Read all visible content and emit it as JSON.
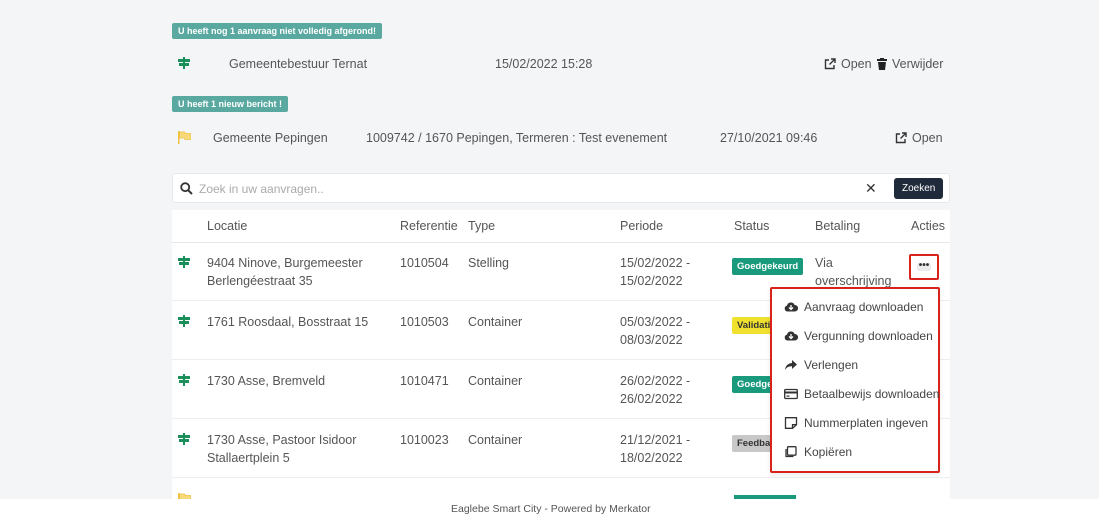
{
  "notifications": [
    {
      "badge": "U heeft nog 1 aanvraag niet volledig afgerond!",
      "org": "Gemeentebestuur Ternat",
      "datetime": "15/02/2022 15:28",
      "open_label": "Open",
      "delete_label": "Verwijder",
      "icon": "road-sign-icon"
    },
    {
      "badge": "U heeft 1 nieuw bericht !",
      "org": "Gemeente Pepingen",
      "description": "1009742 / 1670 Pepingen, Termeren : Test evenement",
      "datetime": "27/10/2021 09:46",
      "open_label": "Open",
      "icon": "flag-icon"
    }
  ],
  "search": {
    "placeholder": "Zoek in uw aanvragen..",
    "value": "",
    "clear_label": "✕",
    "button_label": "Zoeken"
  },
  "table": {
    "headers": {
      "locatie": "Locatie",
      "referentie": "Referentie",
      "type": "Type",
      "periode": "Periode",
      "status": "Status",
      "betaling": "Betaling",
      "acties": "Acties"
    },
    "rows": [
      {
        "locatie_line1": "9404 Ninove, Burgemeester",
        "locatie_line2": "Berlengéestraat 35",
        "referentie": "1010504",
        "type": "Stelling",
        "periode_start": "15/02/2022 -",
        "periode_end": "15/02/2022",
        "status": "Goedgekeurd",
        "betaling_line1": "Via",
        "betaling_line2": "overschrijving"
      },
      {
        "locatie_line1": "1761 Roosdaal, Bosstraat 15",
        "locatie_line2": "",
        "referentie": "1010503",
        "type": "Container",
        "periode_start": "05/03/2022 -",
        "periode_end": "08/03/2022",
        "status": "Validati",
        "betaling_line1": "",
        "betaling_line2": ""
      },
      {
        "locatie_line1": "1730 Asse, Bremveld",
        "locatie_line2": "",
        "referentie": "1010471",
        "type": "Container",
        "periode_start": "26/02/2022 -",
        "periode_end": "26/02/2022",
        "status": "Goedge",
        "betaling_line1": "",
        "betaling_line2": ""
      },
      {
        "locatie_line1": "1730 Asse, Pastoor Isidoor",
        "locatie_line2": "Stallaertplein 5",
        "referentie": "1010023",
        "type": "Container",
        "periode_start": "21/12/2021 -",
        "periode_end": "18/02/2022",
        "status": "Feedba",
        "betaling_line1": "",
        "betaling_line2": ""
      }
    ],
    "actions_button_label": "•••"
  },
  "actions_menu": {
    "items": [
      {
        "label": "Aanvraag downloaden",
        "icon": "cloud-download-icon"
      },
      {
        "label": "Vergunning downloaden",
        "icon": "cloud-download-icon"
      },
      {
        "label": "Verlengen",
        "icon": "share-arrow-icon"
      },
      {
        "label": "Betaalbewijs downloaden",
        "icon": "credit-card-icon"
      },
      {
        "label": "Nummerplaten ingeven",
        "icon": "sticky-note-icon"
      },
      {
        "label": "Kopiëren",
        "icon": "copy-icon"
      }
    ]
  },
  "footer": {
    "text": "Eaglebe Smart City - Powered by Merkator"
  },
  "colors": {
    "badge": "#5aa9a1",
    "status_approved": "#1a9a7d",
    "status_validation": "#f1e12f",
    "status_feedback": "#c8c8c8",
    "highlight": "#d8231b",
    "button_dark": "#1f2a3a",
    "sign_icon": "#1a8f5a",
    "flag_icon": "#f0c040"
  }
}
